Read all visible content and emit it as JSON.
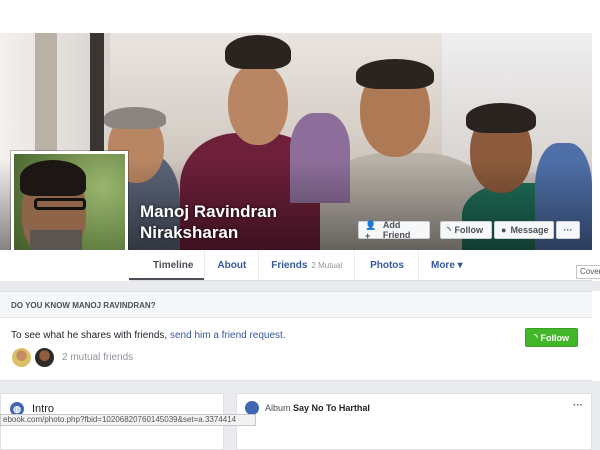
{
  "profile": {
    "name_line1": "Manoj Ravindran",
    "name_line2": "Niraksharan"
  },
  "cover_actions": {
    "add_friend": "Add Friend",
    "follow": "Follow",
    "message": "Message",
    "more": "···"
  },
  "nav": {
    "timeline": "Timeline",
    "about": "About",
    "friends": "Friends",
    "friends_sub": "2 Mutual",
    "photos": "Photos",
    "more": "More ▾"
  },
  "tooltip": "Cover",
  "dyk": {
    "heading": "DO YOU KNOW MANOJ RAVINDRAN?",
    "text": "To see what he shares with friends, ",
    "link": "send him a friend request.",
    "follow": "Follow",
    "mutual": "2 mutual friends"
  },
  "intro": {
    "title": "Intro"
  },
  "album": {
    "label": "Album",
    "name": "Say No To Harthal",
    "more": "···"
  },
  "statusbar": "ebook.com/photo.php?fbid=10206820760145039&set=a.3374414",
  "colors": {
    "brand_blue": "#4267b2",
    "link": "#365899",
    "green": "#42b72a",
    "bg": "#e9ebee"
  }
}
